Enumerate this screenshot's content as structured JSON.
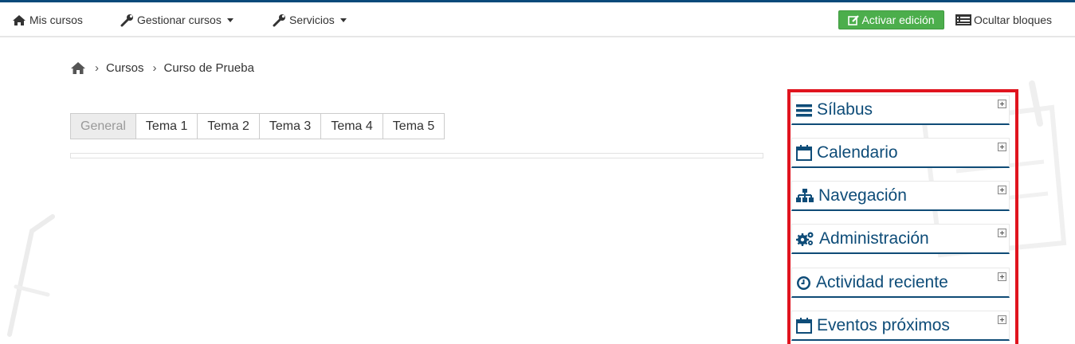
{
  "navbar": {
    "my_courses": "Mis cursos",
    "manage_courses": "Gestionar cursos",
    "services": "Servicios",
    "edit_button": "Activar edición",
    "hide_blocks": "Ocultar bloques"
  },
  "breadcrumb": {
    "items": [
      "Cursos",
      "Curso de Prueba"
    ]
  },
  "tabs": [
    "General",
    "Tema 1",
    "Tema 2",
    "Tema 3",
    "Tema 4",
    "Tema 5"
  ],
  "blocks": [
    {
      "title": "Sílabus",
      "icon": "list-icon"
    },
    {
      "title": "Calendario",
      "icon": "calendar-icon"
    },
    {
      "title": "Navegación",
      "icon": "sitemap-icon"
    },
    {
      "title": "Administración",
      "icon": "gears-icon"
    },
    {
      "title": "Actividad reciente",
      "icon": "clock-icon"
    },
    {
      "title": "Eventos próximos",
      "icon": "calendar-icon"
    }
  ],
  "colors": {
    "accent": "#0e4c78",
    "edit_button": "#4cae4c",
    "highlight_border": "#e0141e"
  }
}
